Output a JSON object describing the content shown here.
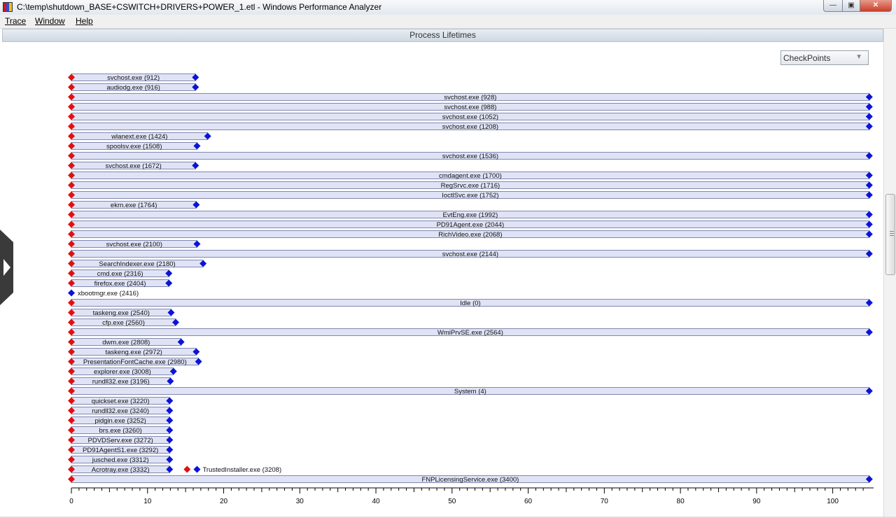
{
  "window": {
    "title": "C:\\temp\\shutdown_BASE+CSWITCH+DRIVERS+POWER_1.etl - Windows Performance Analyzer",
    "controls": {
      "minimize": "—",
      "maximize": "▣",
      "close": "✕"
    }
  },
  "menu": [
    "Trace",
    "Window",
    "Help"
  ],
  "panel": {
    "title": "Process Lifetimes"
  },
  "dropdown": {
    "selected": "CheckPoints",
    "arrow_icon": "chevron-down-icon"
  },
  "colors": {
    "bar_fill": "#dfe3f5",
    "bar_stroke": "#8088b0",
    "start_marker": "#e01010",
    "end_marker": "#0a14d8"
  },
  "chart_data": {
    "type": "timeline",
    "x_axis": {
      "min": 0,
      "max": 100,
      "ticks": [
        0,
        10,
        20,
        30,
        40,
        50,
        60,
        70,
        80,
        90,
        100
      ]
    },
    "processes": [
      {
        "label": "svchost.exe (912)",
        "start": 0,
        "end": 16.3
      },
      {
        "label": "audiodg.exe (916)",
        "start": 0,
        "end": 16.3
      },
      {
        "label": "svchost.exe (928)",
        "start": 0,
        "end": 104.8
      },
      {
        "label": "svchost.exe (988)",
        "start": 0,
        "end": 104.8
      },
      {
        "label": "svchost.exe (1052)",
        "start": 0,
        "end": 104.8
      },
      {
        "label": "svchost.exe (1208)",
        "start": 0,
        "end": 104.8
      },
      {
        "label": "wlanext.exe (1424)",
        "start": 0,
        "end": 17.9
      },
      {
        "label": "spoolsv.exe (1508)",
        "start": 0,
        "end": 16.5
      },
      {
        "label": "svchost.exe (1536)",
        "start": 0,
        "end": 104.8
      },
      {
        "label": "svchost.exe (1672)",
        "start": 0,
        "end": 16.3
      },
      {
        "label": "cmdagent.exe (1700)",
        "start": 0,
        "end": 104.8
      },
      {
        "label": "RegSrvc.exe (1716)",
        "start": 0,
        "end": 104.8
      },
      {
        "label": "IoctlSvc.exe (1752)",
        "start": 0,
        "end": 104.8
      },
      {
        "label": "ekrn.exe (1764)",
        "start": 0,
        "end": 16.4
      },
      {
        "label": "EvtEng.exe (1992)",
        "start": 0,
        "end": 104.8
      },
      {
        "label": "PD91Agent.exe (2044)",
        "start": 0,
        "end": 104.8
      },
      {
        "label": "RichVideo.exe (2068)",
        "start": 0,
        "end": 104.8
      },
      {
        "label": "svchost.exe (2100)",
        "start": 0,
        "end": 16.5
      },
      {
        "label": "svchost.exe (2144)",
        "start": 0,
        "end": 104.8
      },
      {
        "label": "SearchIndexer.exe (2180)",
        "start": 0,
        "end": 17.3
      },
      {
        "label": "cmd.exe (2316)",
        "start": 0,
        "end": 12.8
      },
      {
        "label": "firefox.exe (2404)",
        "start": 0,
        "end": 12.8
      },
      {
        "label": "xbootmgr.exe (2416)",
        "start": 0,
        "end": 0
      },
      {
        "label": "Idle (0)",
        "start": 0,
        "end": 104.8
      },
      {
        "label": "taskeng.exe (2540)",
        "start": 0,
        "end": 13.1
      },
      {
        "label": "cfp.exe (2560)",
        "start": 0,
        "end": 13.7
      },
      {
        "label": "WmiPrvSE.exe (2564)",
        "start": 0,
        "end": 104.8
      },
      {
        "label": "dwm.exe (2808)",
        "start": 0,
        "end": 14.4
      },
      {
        "label": "taskeng.exe (2972)",
        "start": 0,
        "end": 16.4
      },
      {
        "label": "PresentationFontCache.exe (2980)",
        "start": 0,
        "end": 16.7
      },
      {
        "label": "explorer.exe (3008)",
        "start": 0,
        "end": 13.4
      },
      {
        "label": "rundll32.exe (3196)",
        "start": 0,
        "end": 13.0
      },
      {
        "label": "System (4)",
        "start": 0,
        "end": 104.8
      },
      {
        "label": "quickset.exe (3220)",
        "start": 0,
        "end": 12.9
      },
      {
        "label": "rundll32.exe (3240)",
        "start": 0,
        "end": 12.9
      },
      {
        "label": "pidgin.exe (3252)",
        "start": 0,
        "end": 12.9
      },
      {
        "label": "brs.exe (3260)",
        "start": 0,
        "end": 12.9
      },
      {
        "label": "PDVDServ.exe (3272)",
        "start": 0,
        "end": 12.9
      },
      {
        "label": "PD91AgentS1.exe (3292)",
        "start": 0,
        "end": 12.9
      },
      {
        "label": "jusched.exe (3312)",
        "start": 0,
        "end": 12.9
      },
      {
        "label": "Acrotray.exe (3332)",
        "start": 0,
        "end": 12.9,
        "extra": {
          "label": "TrustedInstaller.exe (3208)",
          "start": 15.2,
          "end": 16.5
        }
      },
      {
        "label": "FNPLicensingService.exe (3400)",
        "start": 0,
        "end": 104.8
      }
    ]
  }
}
